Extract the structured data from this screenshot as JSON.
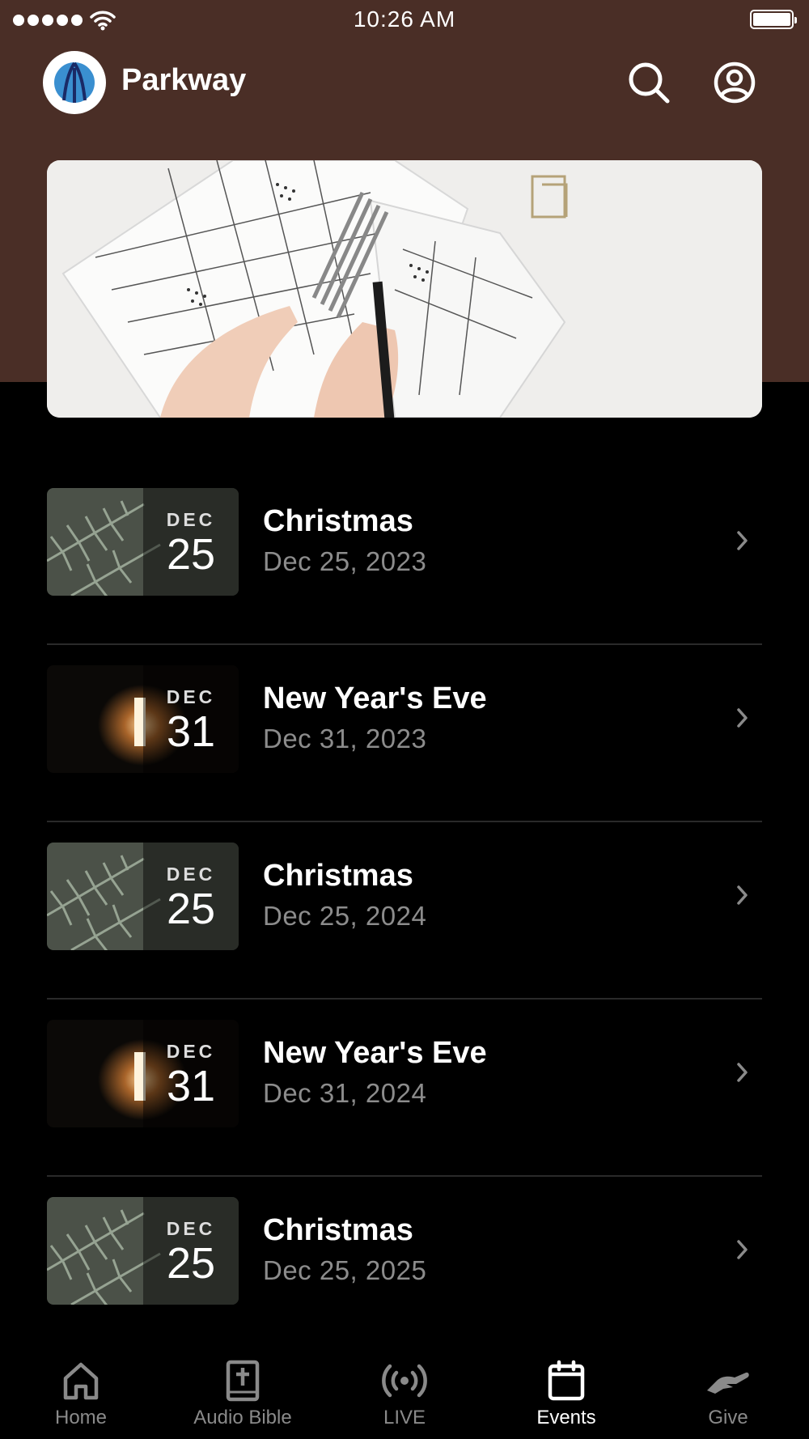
{
  "status_bar": {
    "time": "10:26 AM"
  },
  "header": {
    "title": "Parkway",
    "search_icon": "search-icon",
    "profile_icon": "user-circle-icon"
  },
  "events": [
    {
      "title": "Christmas",
      "date": "Dec 25, 2023",
      "badge_month": "DEC",
      "badge_day": "25",
      "thumb": "pine"
    },
    {
      "title": "New Year's Eve",
      "date": "Dec 31, 2023",
      "badge_month": "DEC",
      "badge_day": "31",
      "thumb": "cave"
    },
    {
      "title": "Christmas",
      "date": "Dec 25, 2024",
      "badge_month": "DEC",
      "badge_day": "25",
      "thumb": "pine"
    },
    {
      "title": "New Year's Eve",
      "date": "Dec 31, 2024",
      "badge_month": "DEC",
      "badge_day": "31",
      "thumb": "cave"
    },
    {
      "title": "Christmas",
      "date": "Dec 25, 2025",
      "badge_month": "DEC",
      "badge_day": "25",
      "thumb": "pine"
    }
  ],
  "tabs": [
    {
      "label": "Home",
      "icon": "home-icon",
      "active": false
    },
    {
      "label": "Audio Bible",
      "icon": "bible-icon",
      "active": false
    },
    {
      "label": "LIVE",
      "icon": "broadcast-icon",
      "active": false
    },
    {
      "label": "Events",
      "icon": "calendar-icon",
      "active": true
    },
    {
      "label": "Give",
      "icon": "give-hand-icon",
      "active": false
    }
  ],
  "colors": {
    "header_bg": "#4a2e26",
    "background": "#000000",
    "secondary_text": "#8c8c8c"
  }
}
